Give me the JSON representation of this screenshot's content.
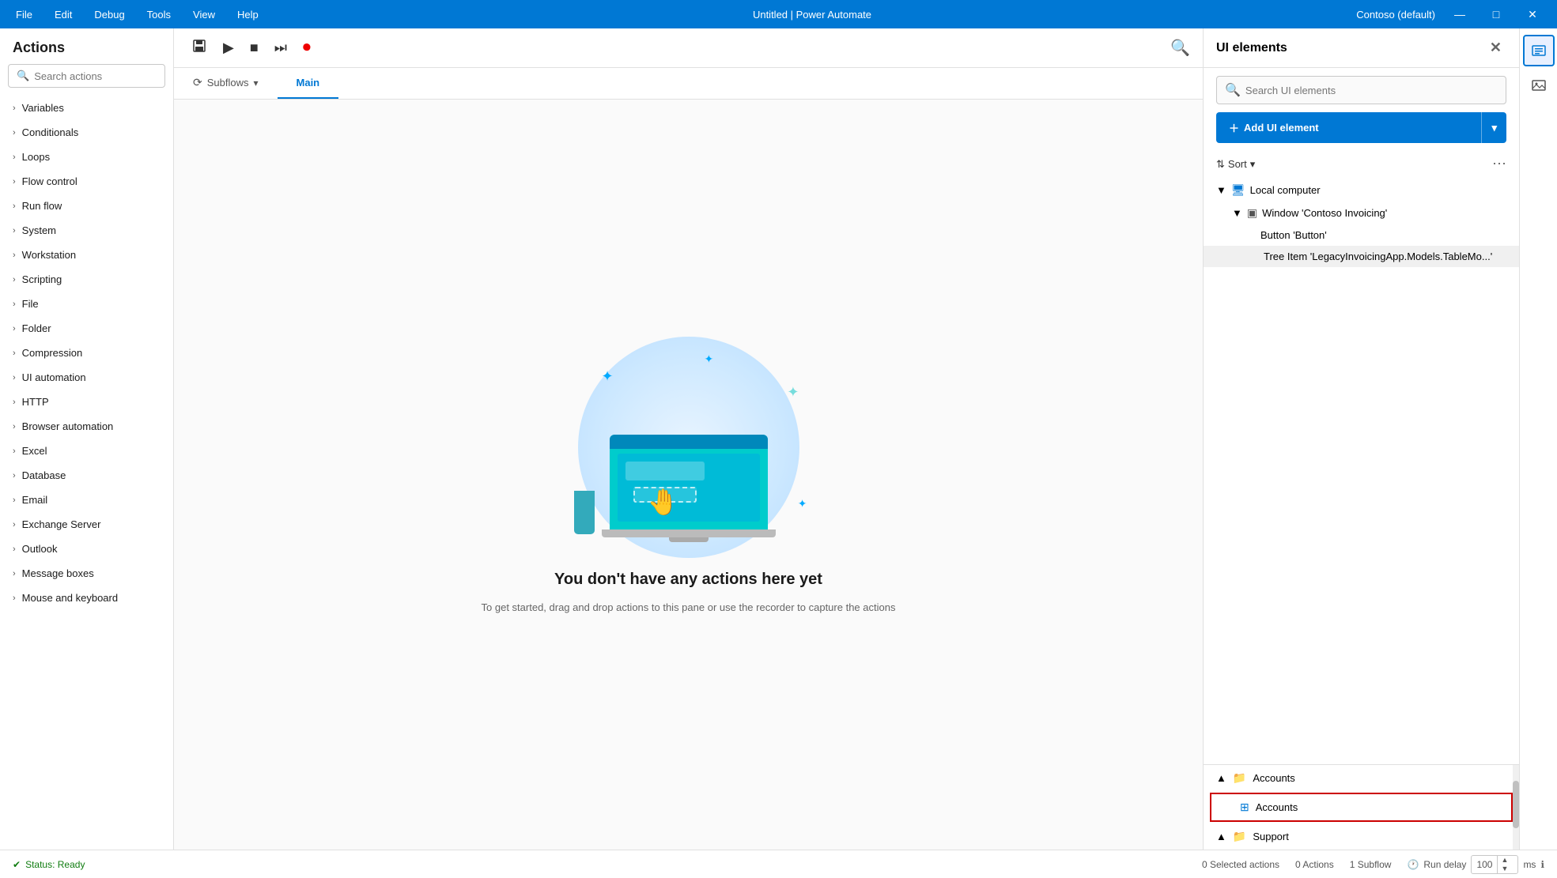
{
  "titlebar": {
    "menus": [
      "File",
      "Edit",
      "Debug",
      "Tools",
      "View",
      "Help"
    ],
    "title": "Untitled | Power Automate",
    "user": "Contoso (default)",
    "controls": [
      "—",
      "□",
      "✕"
    ]
  },
  "actions": {
    "header": "Actions",
    "search_placeholder": "Search actions",
    "items": [
      "Variables",
      "Conditionals",
      "Loops",
      "Flow control",
      "Run flow",
      "System",
      "Workstation",
      "Scripting",
      "File",
      "Folder",
      "Compression",
      "UI automation",
      "HTTP",
      "Browser automation",
      "Excel",
      "Database",
      "Email",
      "Exchange Server",
      "Outlook",
      "Message boxes",
      "Mouse and keyboard"
    ]
  },
  "toolbar": {
    "save_title": "Save",
    "run_title": "Run",
    "stop_title": "Stop",
    "next_title": "Next"
  },
  "tabs": {
    "subflows_label": "Subflows",
    "main_label": "Main"
  },
  "canvas": {
    "empty_title": "You don't have any actions here yet",
    "empty_subtitle": "To get started, drag and drop actions to this pane\nor use the recorder to capture the actions"
  },
  "ui_elements": {
    "header": "UI elements",
    "search_placeholder": "Search UI elements",
    "add_label": "Add UI element",
    "sort_label": "Sort",
    "tree": [
      {
        "level": 0,
        "icon": "monitor",
        "expand": "▼",
        "label": "Local computer"
      },
      {
        "level": 1,
        "icon": "window",
        "expand": "▼",
        "label": "Window 'Contoso Invoicing'"
      },
      {
        "level": 2,
        "icon": "none",
        "expand": "",
        "label": "Button 'Button'"
      },
      {
        "level": 2,
        "icon": "none",
        "expand": "",
        "label": "Tree Item 'LegacyInvoicingApp.Models.TableMo...'"
      }
    ],
    "bottom_tree": [
      {
        "level": 0,
        "icon": "folder",
        "expand": "▲",
        "label": "Accounts"
      },
      {
        "level": 1,
        "icon": "table",
        "expand": "",
        "label": "Accounts",
        "highlighted": true
      },
      {
        "level": 0,
        "icon": "folder",
        "expand": "▲",
        "label": "Support"
      }
    ]
  },
  "status_bar": {
    "status": "Status: Ready",
    "selected_actions": "0 Selected actions",
    "actions_count": "0 Actions",
    "subflow_count": "1 Subflow",
    "run_delay_label": "Run delay",
    "run_delay_value": "100",
    "run_delay_unit": "ms"
  }
}
